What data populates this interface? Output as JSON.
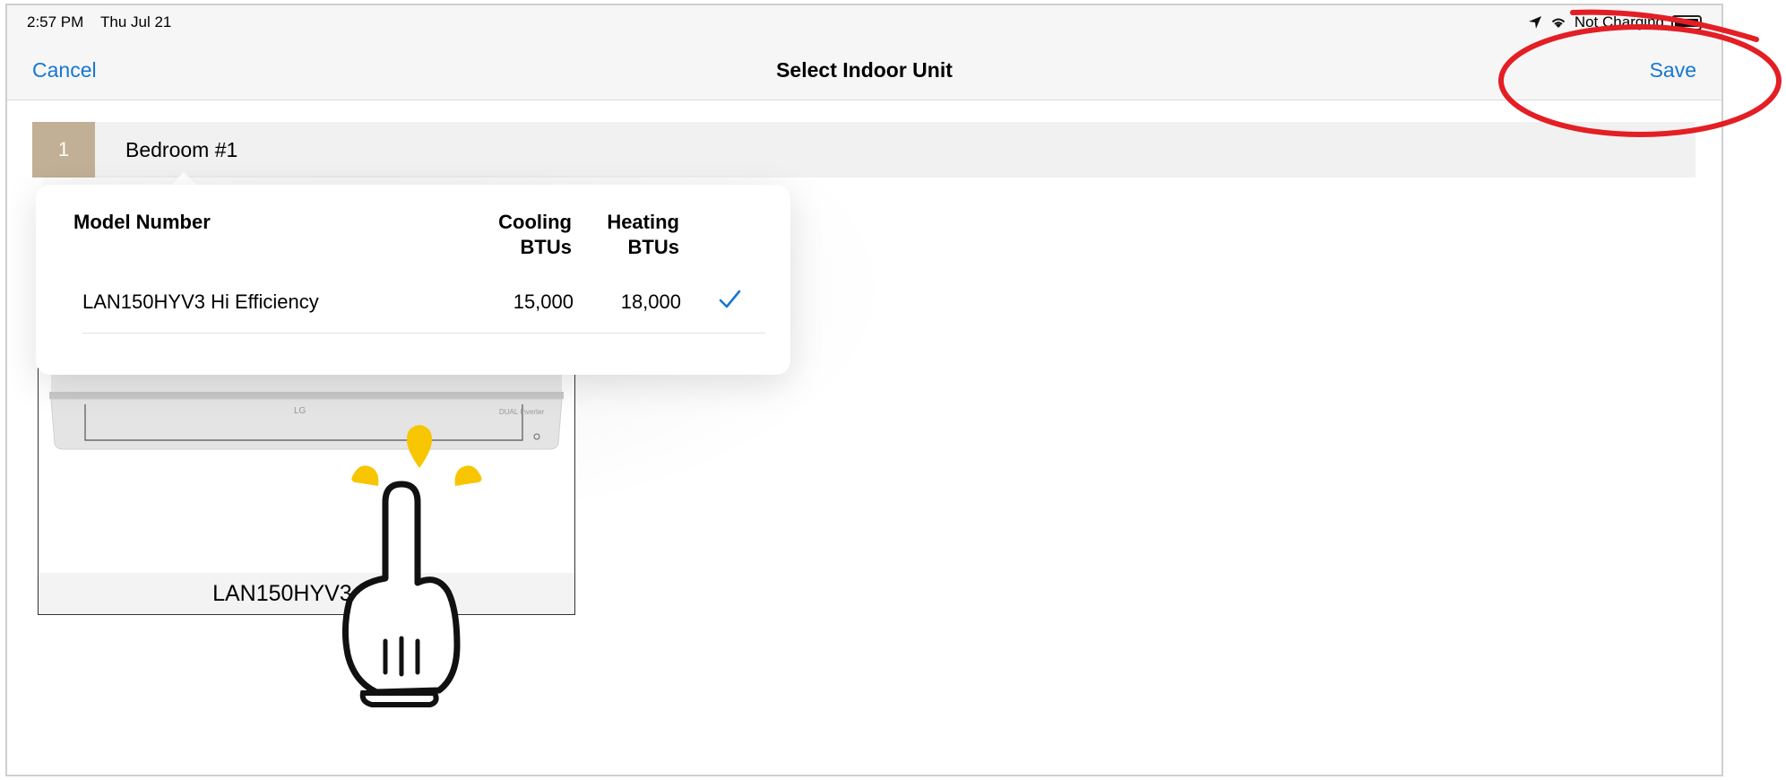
{
  "status_bar": {
    "time": "2:57 PM",
    "date": "Thu Jul 21",
    "charging": "Not Charging"
  },
  "nav": {
    "cancel": "Cancel",
    "title": "Select Indoor Unit",
    "save": "Save"
  },
  "room": {
    "number": "1",
    "name": "Bedroom #1"
  },
  "table": {
    "headers": {
      "model": "Model Number",
      "cooling_line1": "Cooling",
      "cooling_line2": "BTUs",
      "heating_line1": "Heating",
      "heating_line2": "BTUs"
    },
    "rows": [
      {
        "model": "LAN150HYV3 Hi Efficiency",
        "cooling": "15,000",
        "heating": "18,000",
        "selected": true
      }
    ]
  },
  "unit_card": {
    "caption": "LAN150HYV3 Hi E",
    "brand_logo": "LG",
    "product_tag": "DUAL Inverter"
  },
  "colors": {
    "accent": "#1677d2",
    "room_badge": "#c1b095",
    "annotation": "#e31e24",
    "tap_drops": "#f7c600"
  }
}
